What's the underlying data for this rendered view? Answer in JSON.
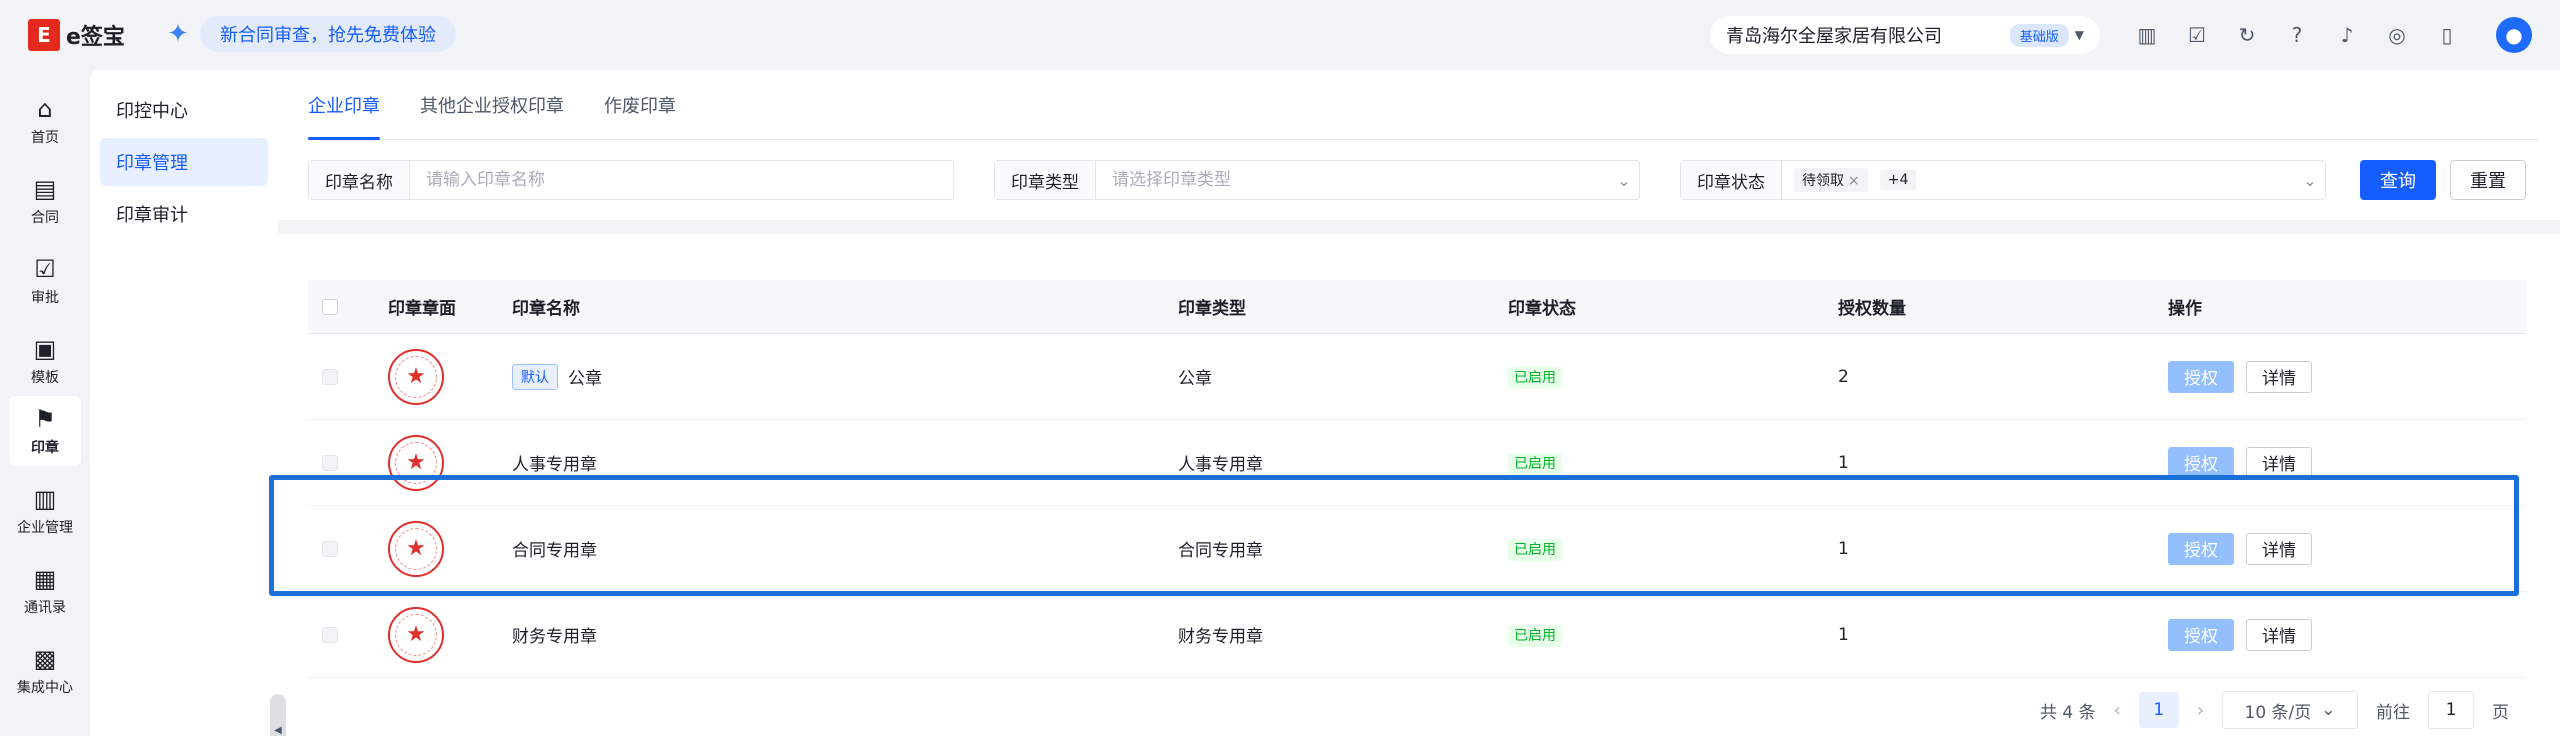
{
  "app": {
    "logo_mark": "E",
    "logo_text": "e签宝"
  },
  "promo": {
    "text": "新合同审查，抢先免费体验"
  },
  "company": {
    "name": "青岛海尔全屋家居有限公司",
    "plan": "基础版"
  },
  "left_nav": [
    {
      "label": "首页",
      "icon": "home-icon",
      "glyph": "⌂"
    },
    {
      "label": "合同",
      "icon": "contract-icon",
      "glyph": "▤"
    },
    {
      "label": "审批",
      "icon": "approval-icon",
      "glyph": "☑"
    },
    {
      "label": "模板",
      "icon": "template-icon",
      "glyph": "▣"
    },
    {
      "label": "印章",
      "icon": "seal-icon",
      "glyph": "⚑"
    },
    {
      "label": "企业管理",
      "icon": "enterprise-icon",
      "glyph": "▥"
    },
    {
      "label": "通讯录",
      "icon": "contacts-icon",
      "glyph": "▦"
    },
    {
      "label": "集成中心",
      "icon": "integration-icon",
      "glyph": "▩"
    }
  ],
  "sub_nav": [
    {
      "label": "印控中心"
    },
    {
      "label": "印章管理"
    },
    {
      "label": "印章审计"
    }
  ],
  "tabs": [
    {
      "label": "企业印章"
    },
    {
      "label": "其他企业授权印章"
    },
    {
      "label": "作废印章"
    }
  ],
  "filters": {
    "name": {
      "label": "印章名称",
      "placeholder": "请输入印章名称"
    },
    "type": {
      "label": "印章类型",
      "placeholder": "请选择印章类型"
    },
    "status": {
      "label": "印章状态",
      "tag": "待领取",
      "more": "+4"
    }
  },
  "buttons": {
    "query": "查询",
    "reset": "重置"
  },
  "table": {
    "headers": [
      "印章章面",
      "印章名称",
      "印章类型",
      "印章状态",
      "授权数量",
      "操作"
    ],
    "default_label": "默认",
    "auth_label": "授权",
    "detail_label": "详情",
    "rows": [
      {
        "name": "公章",
        "type": "公章",
        "status": "已启用",
        "count": "2",
        "is_default": true
      },
      {
        "name": "人事专用章",
        "type": "人事专用章",
        "status": "已启用",
        "count": "1",
        "is_default": false
      },
      {
        "name": "合同专用章",
        "type": "合同专用章",
        "status": "已启用",
        "count": "1",
        "is_default": false
      },
      {
        "name": "财务专用章",
        "type": "财务专用章",
        "status": "已启用",
        "count": "1",
        "is_default": false
      }
    ]
  },
  "pagination": {
    "total": "共 4 条",
    "current": "1",
    "page_size": "10 条/页",
    "goto_label": "前往",
    "goto_value": "1",
    "page_unit": "页"
  }
}
